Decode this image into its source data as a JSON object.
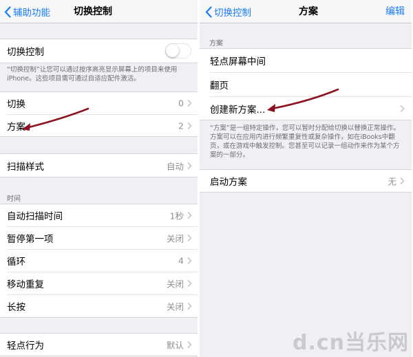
{
  "left": {
    "navbar": {
      "back_label": "辅助功能",
      "title": "切换控制"
    },
    "toggle_row": {
      "label": "切换控制",
      "on": false
    },
    "toggle_footnote": "“切换控制”让您可以通过按序高亮显示屏幕上的项目来使用iPhone。这些项目需可通过自适应配件激活。",
    "group1": [
      {
        "label": "切换",
        "value": "0"
      },
      {
        "label": "方案",
        "value": "2"
      }
    ],
    "scan_style": {
      "label": "扫描样式",
      "value": "自动"
    },
    "timing_header": "时间",
    "timing": [
      {
        "label": "自动扫描时间",
        "value": "1秒"
      },
      {
        "label": "暂停第一项",
        "value": "关闭"
      },
      {
        "label": "循环",
        "value": "4"
      },
      {
        "label": "移动重复",
        "value": "关闭"
      },
      {
        "label": "长按",
        "value": "关闭"
      }
    ],
    "tap_behavior": {
      "label": "轻点行为",
      "value": "默认"
    }
  },
  "right": {
    "navbar": {
      "back_label": "切换控制",
      "title": "方案",
      "action": "编辑"
    },
    "recipes_header": "方案",
    "recipes": [
      {
        "label": "轻点屏幕中间"
      },
      {
        "label": "翻页"
      },
      {
        "label": "创建新方案..."
      }
    ],
    "recipes_footnote": "“方案”是一组特定操作，您可以暂时分配给切换以替换正常操作。方案可以在应用内进行频繁重复性或复杂操作，如在iBooks中翻页，或在游戏中触发控制。您甚至可以记录一组动作来作为某个方案的一部分。",
    "launch_recipe": {
      "label": "启动方案",
      "value": "无"
    }
  },
  "watermark": "d.cn当乐网",
  "colors": {
    "accent": "#1a7cf9",
    "annotation_arrow": "#8b1220",
    "background": "#efeff4"
  }
}
